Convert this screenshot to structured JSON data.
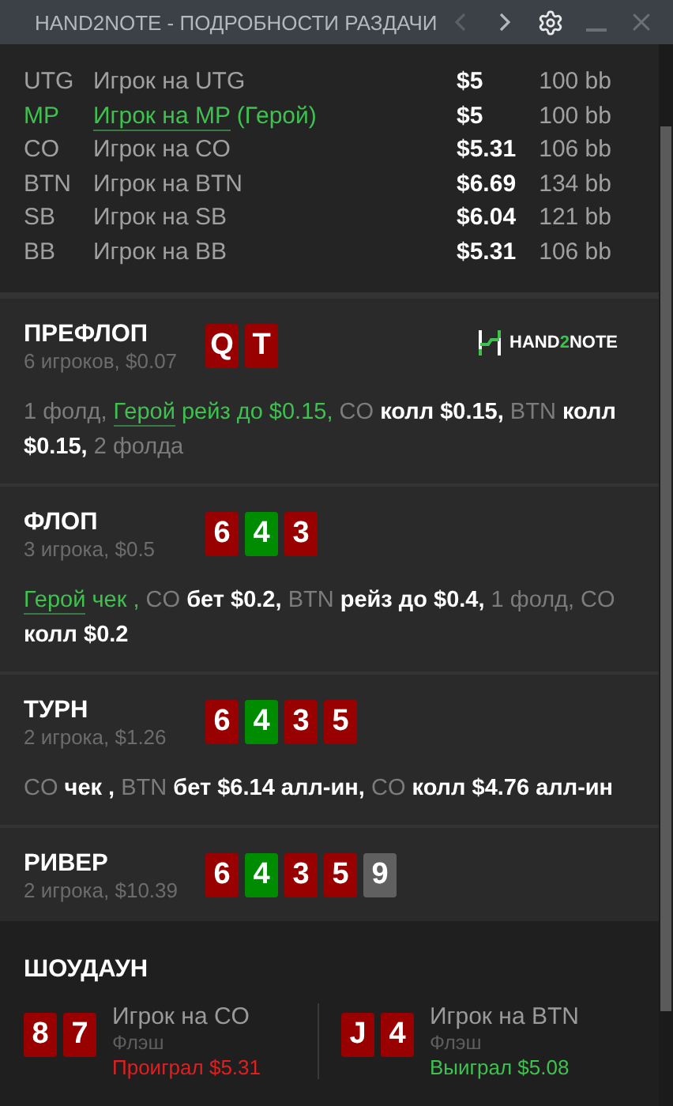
{
  "window": {
    "title": "HAND2NOTE - ПОДРОБНОСТИ РАЗДАЧИ"
  },
  "players": [
    {
      "position": "UTG",
      "name": "Игрок на UTG",
      "hero": false,
      "stack": "$5",
      "bb": "100 bb"
    },
    {
      "position": "MP",
      "name": "Игрок на MP",
      "hero": true,
      "hero_tag": "(Герой)",
      "stack": "$5",
      "bb": "100 bb"
    },
    {
      "position": "CO",
      "name": "Игрок на CO",
      "hero": false,
      "stack": "$5.31",
      "bb": "106 bb"
    },
    {
      "position": "BTN",
      "name": "Игрок на BTN",
      "hero": false,
      "stack": "$6.69",
      "bb": "134 bb"
    },
    {
      "position": "SB",
      "name": "Игрок на SB",
      "hero": false,
      "stack": "$6.04",
      "bb": "121 bb"
    },
    {
      "position": "BB",
      "name": "Игрок на BB",
      "hero": false,
      "stack": "$5.31",
      "bb": "106 bb"
    }
  ],
  "logo": {
    "left": "HAND",
    "middle": "2",
    "right": "NOTE"
  },
  "streets": [
    {
      "title": "ПРЕФЛОП",
      "info": "6 игроков, $0.07",
      "logo": true,
      "cards": [
        {
          "rank": "Q",
          "color": "#990000"
        },
        {
          "rank": "T",
          "color": "#990000"
        }
      ],
      "actions": [
        {
          "text": "1 фолд,",
          "kind": "muted"
        },
        {
          "text": "Герой",
          "kind": "hero"
        },
        {
          "text": "рейз до $0.15,",
          "kind": "heroaction"
        },
        {
          "text": "CO",
          "kind": "muted"
        },
        {
          "text": "колл $0.15,",
          "kind": "action"
        },
        {
          "text": "BTN",
          "kind": "muted"
        },
        {
          "text": "колл $0.15,",
          "kind": "action"
        },
        {
          "text": "2 фолда",
          "kind": "muted"
        }
      ]
    },
    {
      "title": "ФЛОП",
      "info": "3 игрока, $0.5",
      "logo": false,
      "cards": [
        {
          "rank": "6",
          "color": "#990000"
        },
        {
          "rank": "4",
          "color": "#008c00"
        },
        {
          "rank": "3",
          "color": "#990000"
        }
      ],
      "actions": [
        {
          "text": "Герой",
          "kind": "hero"
        },
        {
          "text": "чек ,",
          "kind": "heroaction"
        },
        {
          "text": "CO",
          "kind": "muted"
        },
        {
          "text": "бет $0.2,",
          "kind": "action"
        },
        {
          "text": "BTN",
          "kind": "muted"
        },
        {
          "text": "рейз до $0.4,",
          "kind": "action"
        },
        {
          "text": "1 фолд, CO",
          "kind": "muted"
        },
        {
          "text": "колл $0.2",
          "kind": "action"
        }
      ]
    },
    {
      "title": "ТУРН",
      "info": "2 игрока, $1.26",
      "logo": false,
      "cards": [
        {
          "rank": "6",
          "color": "#990000"
        },
        {
          "rank": "4",
          "color": "#008c00"
        },
        {
          "rank": "3",
          "color": "#990000"
        },
        {
          "rank": "5",
          "color": "#990000"
        }
      ],
      "actions": [
        {
          "text": "CO",
          "kind": "muted"
        },
        {
          "text": "чек ,",
          "kind": "action"
        },
        {
          "text": "BTN",
          "kind": "muted"
        },
        {
          "text": "бет $6.14 алл-ин,",
          "kind": "action"
        },
        {
          "text": "CO",
          "kind": "muted"
        },
        {
          "text": "колл $4.76 алл-ин",
          "kind": "action"
        }
      ]
    },
    {
      "title": "РИВЕР",
      "info": "2 игрока, $10.39",
      "logo": false,
      "cards": [
        {
          "rank": "6",
          "color": "#990000"
        },
        {
          "rank": "4",
          "color": "#008c00"
        },
        {
          "rank": "3",
          "color": "#990000"
        },
        {
          "rank": "5",
          "color": "#990000"
        },
        {
          "rank": "9",
          "color": "#606060"
        }
      ]
    }
  ],
  "showdown": {
    "title": "ШОУДАУН",
    "hands": [
      {
        "cards": [
          {
            "rank": "8",
            "color": "#990000"
          },
          {
            "rank": "7",
            "color": "#990000"
          }
        ],
        "name": "Игрок на CO",
        "hand": "Флэш",
        "result": "Проиграл $5.31",
        "won": false
      },
      {
        "cards": [
          {
            "rank": "J",
            "color": "#990000"
          },
          {
            "rank": "4",
            "color": "#990000"
          }
        ],
        "name": "Игрок на BTN",
        "hand": "Флэш",
        "result": "Выиграл $5.08",
        "won": true
      }
    ]
  }
}
